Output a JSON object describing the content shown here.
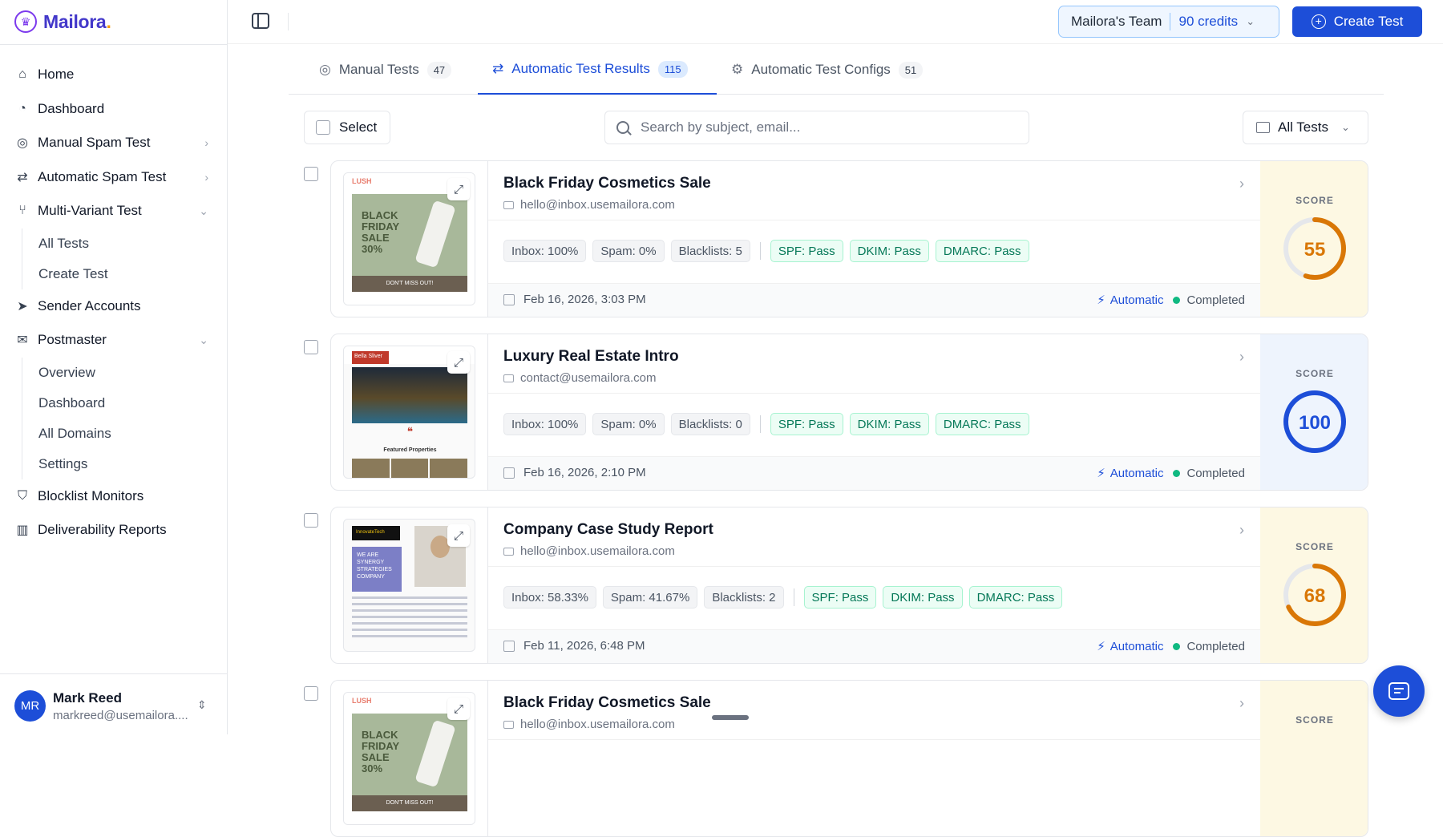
{
  "brand": {
    "name": "Mailora",
    "dot": "."
  },
  "sidebar": {
    "items": [
      {
        "label": "Home",
        "icon": "home-icon"
      },
      {
        "label": "Dashboard",
        "icon": "dashboard-icon"
      },
      {
        "label": "Manual Spam Test",
        "icon": "target-icon",
        "chevron": "right"
      },
      {
        "label": "Automatic Spam Test",
        "icon": "repeat-icon",
        "chevron": "right"
      },
      {
        "label": "Multi-Variant Test",
        "icon": "branch-icon",
        "chevron": "down",
        "children": [
          "All Tests",
          "Create Test"
        ]
      },
      {
        "label": "Sender Accounts",
        "icon": "send-icon"
      },
      {
        "label": "Postmaster",
        "icon": "mail-icon",
        "chevron": "down",
        "children": [
          "Overview",
          "Dashboard",
          "All Domains",
          "Settings"
        ]
      },
      {
        "label": "Blocklist Monitors",
        "icon": "shield-icon"
      },
      {
        "label": "Deliverability Reports",
        "icon": "bar-chart-icon"
      }
    ]
  },
  "user": {
    "initials": "MR",
    "name": "Mark Reed",
    "email": "markreed@usemailora...."
  },
  "topbar": {
    "team": "Mailora's Team",
    "credits": "90 credits",
    "create_label": "Create Test"
  },
  "tabs": [
    {
      "label": "Manual Tests",
      "count": "47",
      "active": false
    },
    {
      "label": "Automatic Test Results",
      "count": "115",
      "active": true
    },
    {
      "label": "Automatic Test Configs",
      "count": "51",
      "active": false
    }
  ],
  "toolbar": {
    "select_label": "Select",
    "search_placeholder": "Search by subject, email...",
    "filter_label": "All Tests"
  },
  "colors": {
    "accent": "#1d4ed8",
    "score_mid": "#d97706",
    "score_high": "#1d4ed8",
    "pass_green": "#047857"
  },
  "results": [
    {
      "title": "Black Friday Cosmetics Sale",
      "email": "hello@inbox.usemailora.com",
      "stats": [
        "Inbox: 100%",
        "Spam: 0%",
        "Blacklists: 5"
      ],
      "auth": [
        "SPF: Pass",
        "DKIM: Pass",
        "DMARC: Pass"
      ],
      "date": "Feb 16, 2026, 3:03 PM",
      "mode": "Automatic",
      "status": "Completed",
      "score_label": "SCORE",
      "score": "55",
      "thumb": "blackfriday"
    },
    {
      "title": "Luxury Real Estate Intro",
      "email": "contact@usemailora.com",
      "stats": [
        "Inbox: 100%",
        "Spam: 0%",
        "Blacklists: 0"
      ],
      "auth": [
        "SPF: Pass",
        "DKIM: Pass",
        "DMARC: Pass"
      ],
      "date": "Feb 16, 2026, 2:10 PM",
      "mode": "Automatic",
      "status": "Completed",
      "score_label": "SCORE",
      "score": "100",
      "thumb": "realestate"
    },
    {
      "title": "Company Case Study Report",
      "email": "hello@inbox.usemailora.com",
      "stats": [
        "Inbox: 58.33%",
        "Spam: 41.67%",
        "Blacklists: 2"
      ],
      "auth": [
        "SPF: Pass",
        "DKIM: Pass",
        "DMARC: Pass"
      ],
      "date": "Feb 11, 2026, 6:48 PM",
      "mode": "Automatic",
      "status": "Completed",
      "score_label": "SCORE",
      "score": "68",
      "thumb": "casestudy"
    },
    {
      "title": "Black Friday Cosmetics Sale",
      "email": "hello@inbox.usemailora.com",
      "stats": [],
      "auth": [],
      "date": "",
      "mode": "",
      "status": "",
      "score_label": "SCORE",
      "score": "",
      "thumb": "blackfriday"
    }
  ],
  "thumb_text": {
    "blackfriday": {
      "brand": "LUSH",
      "headline": "BLACK FRIDAY SALE 30%",
      "bar": "DON'T MISS OUT!"
    },
    "realestate": {
      "brand": "Bella Sliver",
      "featured": "Featured Properties"
    },
    "casestudy": {
      "brand": "InnovateTech",
      "headline": "WE ARE SYNERGY STRATEGIES COMPANY"
    }
  }
}
